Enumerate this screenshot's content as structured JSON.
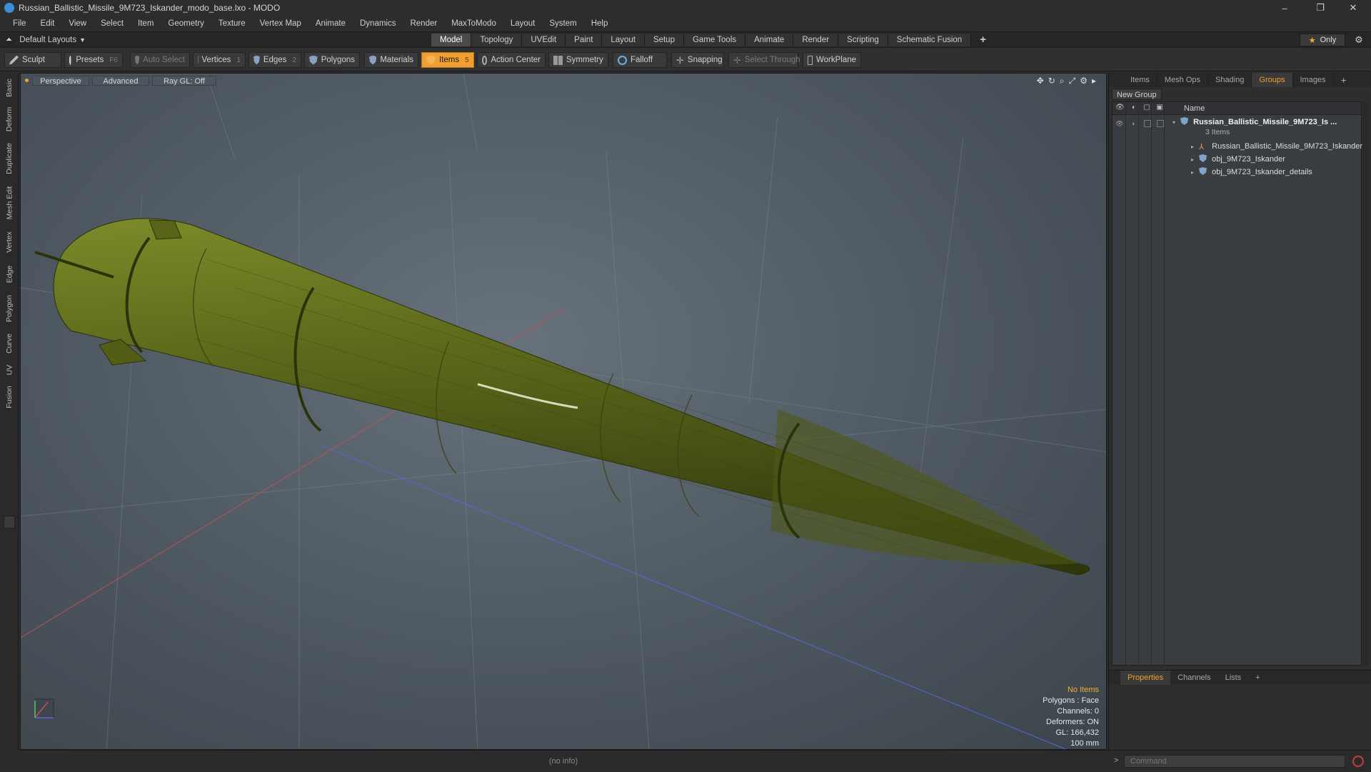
{
  "window": {
    "title": "Russian_Ballistic_Missile_9M723_Iskander_modo_base.lxo - MODO",
    "controls": [
      "–",
      "❐",
      "✕"
    ]
  },
  "menu": [
    "File",
    "Edit",
    "View",
    "Select",
    "Item",
    "Geometry",
    "Texture",
    "Vertex Map",
    "Animate",
    "Dynamics",
    "Render",
    "MaxToModo",
    "Layout",
    "System",
    "Help"
  ],
  "layout_selector": "Default Layouts",
  "mode_tabs": [
    "Model",
    "Topology",
    "UVEdit",
    "Paint",
    "Layout",
    "Setup",
    "Game Tools",
    "Animate",
    "Render",
    "Scripting",
    "Schematic Fusion"
  ],
  "mode_tabs_active": "Model",
  "only_label": "Only",
  "toolbar": {
    "sculpt": "Sculpt",
    "presets": "Presets",
    "presets_key": "F6",
    "auto_select": "Auto Select",
    "vertices": "Vertices",
    "vertices_key": "1",
    "edges": "Edges",
    "edges_key": "2",
    "polygons": "Polygons",
    "materials": "Materials",
    "items": "Items",
    "items_key": "5",
    "action_center": "Action Center",
    "symmetry": "Symmetry",
    "falloff": "Falloff",
    "snapping": "Snapping",
    "select_through": "Select Through",
    "workplane": "WorkPlane"
  },
  "left_tabs": [
    "Basic",
    "Deform",
    "Duplicate",
    "Mesh Edit",
    "Vertex",
    "Edge",
    "Polygon",
    "Curve",
    "UV",
    "Fusion"
  ],
  "viewport": {
    "view": "Perspective",
    "shading": "Advanced",
    "raygl": "Ray GL: Off",
    "stats": {
      "selection": "No Items",
      "polygons": "Polygons : Face",
      "channels": "Channels: 0",
      "deformers": "Deformers: ON",
      "gl": "GL: 166,432",
      "scale": "100 mm"
    },
    "status": "(no info)"
  },
  "right_panel": {
    "tabs": [
      "Items",
      "Mesh Ops",
      "Shading",
      "Groups",
      "Images"
    ],
    "active_tab": "Groups",
    "new_group": "New Group",
    "col_name": "Name",
    "tree": {
      "root": "Russian_Ballistic_Missile_9M723_Is ...",
      "root_sub": "3 Items",
      "children": [
        {
          "label": "Russian_Ballistic_Missile_9M723_Iskander",
          "icon": "locator-icon"
        },
        {
          "label": "obj_9M723_Iskander",
          "icon": "mesh-icon"
        },
        {
          "label": "obj_9M723_Iskander_details",
          "icon": "mesh-icon"
        }
      ]
    }
  },
  "properties_panel": {
    "tabs": [
      "Properties",
      "Channels",
      "Lists"
    ],
    "active_tab": "Properties"
  },
  "command": {
    "prompt": ">",
    "placeholder": "Command"
  },
  "colors": {
    "accent": "#f0a030",
    "missile": "#5f6a1c",
    "viewport_bg": "#5a646d"
  }
}
